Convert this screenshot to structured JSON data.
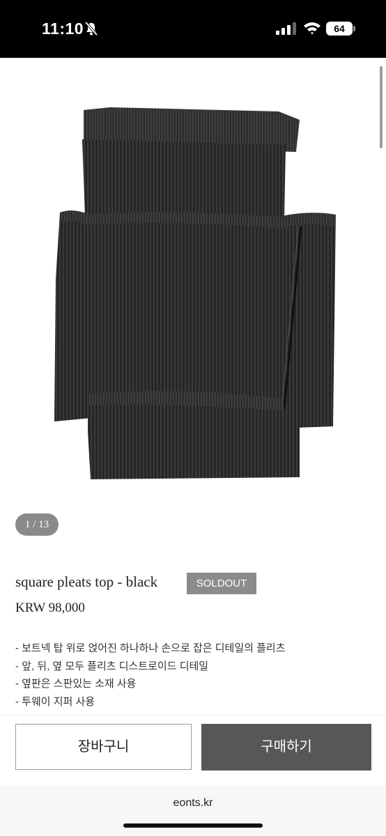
{
  "status_bar": {
    "time": "11:10",
    "battery": "64",
    "icons": [
      "bell-slash-icon",
      "signal-icon",
      "wifi-icon",
      "battery-icon"
    ]
  },
  "gallery": {
    "counter": "1 / 13"
  },
  "product": {
    "name": "square pleats top - black",
    "status_badge": "SOLDOUT",
    "price": "KRW 98,000",
    "description": [
      "- 보트넥 탑 위로 얹어진 하나하나 손으로 잡은 디테일의 플리츠",
      "- 앞, 뒤, 옆 모두 플리츠 디스트로이드 디테일",
      "- 옆판은 스판있는 소재 사용",
      "- 투웨이 지퍼 사용"
    ]
  },
  "actions": {
    "cart_label": "장바구니",
    "buy_label": "구매하기"
  },
  "browser": {
    "url": "eonts.kr"
  },
  "colors": {
    "status_bar_bg": "#000000",
    "badge_bg": "#8b8b8b",
    "buy_button_bg": "#575757",
    "garment": "#2a2a2a"
  }
}
